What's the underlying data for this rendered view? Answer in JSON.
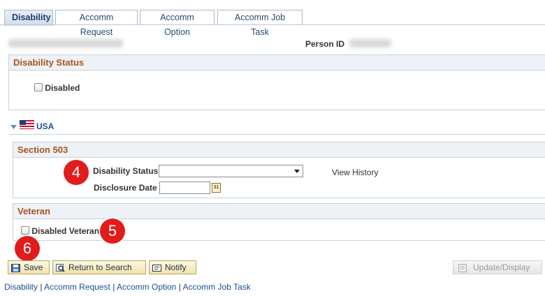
{
  "tabs": [
    {
      "label": "Disability",
      "active": true
    },
    {
      "label": "Accomm Request"
    },
    {
      "label": "Accomm Option"
    },
    {
      "label": "Accomm Job Task"
    }
  ],
  "person": {
    "id_label": "Person ID"
  },
  "disability_status": {
    "title": "Disability Status",
    "disabled_label": "Disabled"
  },
  "country": {
    "label": "USA"
  },
  "section503": {
    "title": "Section 503",
    "status_label": "Disability Status",
    "status_value": "",
    "view_history": "View History",
    "disclosure_label": "Disclosure Date",
    "disclosure_value": "",
    "calendar_icon_text": "31"
  },
  "veteran": {
    "title": "Veteran",
    "disabled_veteran_label": "Disabled Veteran"
  },
  "badges": {
    "b4": "4",
    "b5": "5",
    "b6": "6"
  },
  "toolbar": {
    "save": "Save",
    "return": "Return to Search",
    "notify": "Notify",
    "update": "Update/Display"
  },
  "footer_links": {
    "l1": "Disability",
    "l2": "Accomm Request",
    "l3": "Accomm Option",
    "l4": "Accomm Job Task",
    "sep": "|"
  },
  "colors": {
    "section_title": "#a8541c",
    "badge": "#e21b1b",
    "link": "#1d4f91"
  }
}
